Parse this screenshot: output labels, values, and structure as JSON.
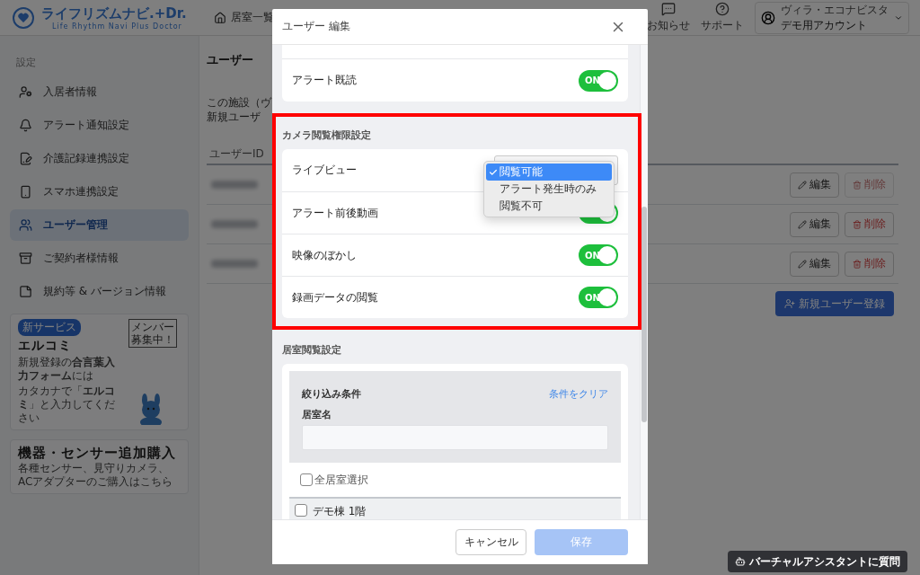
{
  "header": {
    "logo": {
      "title": "ライフリズムナビ.+Dr.",
      "subtitle": "Life Rhythm Navi Plus Doctor"
    },
    "nav_link": "居室一覧",
    "icons": [
      {
        "kind": "notice",
        "label": "お知らせ"
      },
      {
        "kind": "support",
        "label": "サポート"
      }
    ],
    "account": {
      "facility": "ヴィラ・エコナビスタ",
      "name": "デモ用アカウント"
    }
  },
  "sidebar": {
    "heading": "設定",
    "items": [
      {
        "kind": "resident",
        "label": "入居者情報",
        "selected": false
      },
      {
        "kind": "alert",
        "label": "アラート通知設定",
        "selected": false
      },
      {
        "kind": "care",
        "label": "介護記録連携設定",
        "selected": false
      },
      {
        "kind": "phone",
        "label": "スマホ連携設定",
        "selected": false
      },
      {
        "kind": "users",
        "label": "ユーザー管理",
        "selected": true
      },
      {
        "kind": "contract",
        "label": "ご契約者様情報",
        "selected": false
      },
      {
        "kind": "terms",
        "label": "規約等 & バージョン情報",
        "selected": false
      }
    ],
    "banners": [
      {
        "kind": "service",
        "badge": "新サービス",
        "title": "エルコミ",
        "lines": [
          "新規登録の**合言葉入力フォーム**には",
          "カタカナで「**エルコミ**」と入力してください"
        ],
        "sign_lines": [
          "メンバー",
          "募集中！"
        ]
      },
      {
        "kind": "purchase",
        "title": "機器・センサー追加購入",
        "text": "各種センサー、見守りカメラ、ACアダプターのご購入はこちら"
      }
    ]
  },
  "main": {
    "title": "ユーザー",
    "description": [
      "この施設（ヴ",
      "新規ユーザ"
    ],
    "table": {
      "columns": [
        "ユーザーID"
      ],
      "rows": [
        {
          "edit": "編集",
          "delete": "削除",
          "delete_disabled": true
        },
        {
          "edit": "編集",
          "delete": "削除",
          "delete_disabled": false
        },
        {
          "edit": "編集",
          "delete": "削除",
          "delete_disabled": false
        }
      ]
    },
    "new_button": "新規ユーザー登録"
  },
  "modal": {
    "title": "ユーザー 編集",
    "sections": [
      {
        "kind": "plain",
        "rows": [
          {
            "kind": "toggle",
            "label": "アラート既読",
            "on": true,
            "toggle_label": "ON"
          }
        ]
      },
      {
        "kind": "highlighted",
        "title": "カメラ閲覧権限設定",
        "rows": [
          {
            "kind": "select",
            "label": "ライブビュー",
            "options": [
              {
                "label": "閲覧可能",
                "selected": true
              },
              {
                "label": "アラート発生時のみ",
                "selected": false
              },
              {
                "label": "閲覧不可",
                "selected": false
              }
            ]
          },
          {
            "kind": "toggle",
            "label": "アラート前後動画",
            "on": true
          },
          {
            "kind": "toggle",
            "label": "映像のぼかし",
            "on": true,
            "toggle_label": "ON"
          },
          {
            "kind": "toggle",
            "label": "録画データの閲覧",
            "on": true,
            "toggle_label": "ON"
          }
        ]
      },
      {
        "kind": "rooms",
        "title": "居室閲覧設定",
        "filter": {
          "title": "絞り込み条件",
          "clear_link": "条件をクリア",
          "field_label": "居室名"
        },
        "select_all": {
          "label": "全居室選択",
          "checked": false
        },
        "groups": [
          {
            "label": "デモ棟 1階",
            "checked": false
          }
        ]
      }
    ],
    "cancel": "キャンセル",
    "save": "保存",
    "save_disabled": true
  },
  "assistant_button": "バーチャルアシスタントに質問"
}
